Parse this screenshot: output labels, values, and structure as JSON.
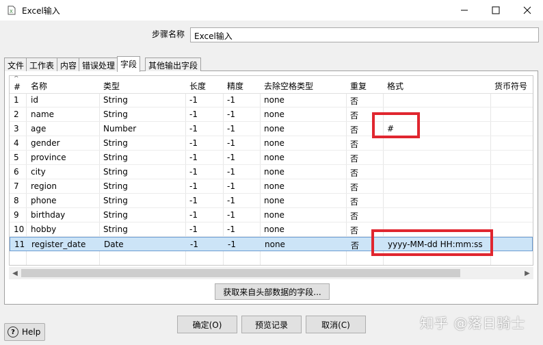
{
  "window": {
    "title": "Excel输入"
  },
  "step": {
    "label": "步骤名称",
    "value": "Excel输入"
  },
  "tabs": [
    "文件",
    "工作表",
    "内容",
    "错误处理",
    "字段",
    "其他输出字段"
  ],
  "columns": [
    "#",
    "名称",
    "类型",
    "长度",
    "精度",
    "去除空格类型",
    "重复",
    "格式",
    "货币符号"
  ],
  "rows": [
    {
      "num": "1",
      "name": "id",
      "type": "String",
      "length": "-1",
      "precision": "-1",
      "trim": "none",
      "repeat": "否",
      "format": ""
    },
    {
      "num": "2",
      "name": "name",
      "type": "String",
      "length": "-1",
      "precision": "-1",
      "trim": "none",
      "repeat": "否",
      "format": ""
    },
    {
      "num": "3",
      "name": "age",
      "type": "Number",
      "length": "-1",
      "precision": "-1",
      "trim": "none",
      "repeat": "否",
      "format": "#"
    },
    {
      "num": "4",
      "name": "gender",
      "type": "String",
      "length": "-1",
      "precision": "-1",
      "trim": "none",
      "repeat": "否",
      "format": ""
    },
    {
      "num": "5",
      "name": "province",
      "type": "String",
      "length": "-1",
      "precision": "-1",
      "trim": "none",
      "repeat": "否",
      "format": ""
    },
    {
      "num": "6",
      "name": "city",
      "type": "String",
      "length": "-1",
      "precision": "-1",
      "trim": "none",
      "repeat": "否",
      "format": ""
    },
    {
      "num": "7",
      "name": "region",
      "type": "String",
      "length": "-1",
      "precision": "-1",
      "trim": "none",
      "repeat": "否",
      "format": ""
    },
    {
      "num": "8",
      "name": "phone",
      "type": "String",
      "length": "-1",
      "precision": "-1",
      "trim": "none",
      "repeat": "否",
      "format": ""
    },
    {
      "num": "9",
      "name": "birthday",
      "type": "String",
      "length": "-1",
      "precision": "-1",
      "trim": "none",
      "repeat": "否",
      "format": ""
    },
    {
      "num": "10",
      "name": "hobby",
      "type": "String",
      "length": "-1",
      "precision": "-1",
      "trim": "none",
      "repeat": "否",
      "format": ""
    },
    {
      "num": "11",
      "name": "register_date",
      "type": "Date",
      "length": "-1",
      "precision": "-1",
      "trim": "none",
      "repeat": "否",
      "format": "yyyy-MM-dd HH:mm:ss"
    }
  ],
  "buttons": {
    "fetch": "获取来自头部数据的字段...",
    "ok": "确定(O)",
    "preview": "预览记录",
    "cancel": "取消(C)",
    "help": "Help"
  },
  "watermark": "知乎 @落日骑士",
  "colors": {
    "highlight": "#e0262f",
    "selected_row": "#cce4f7"
  }
}
